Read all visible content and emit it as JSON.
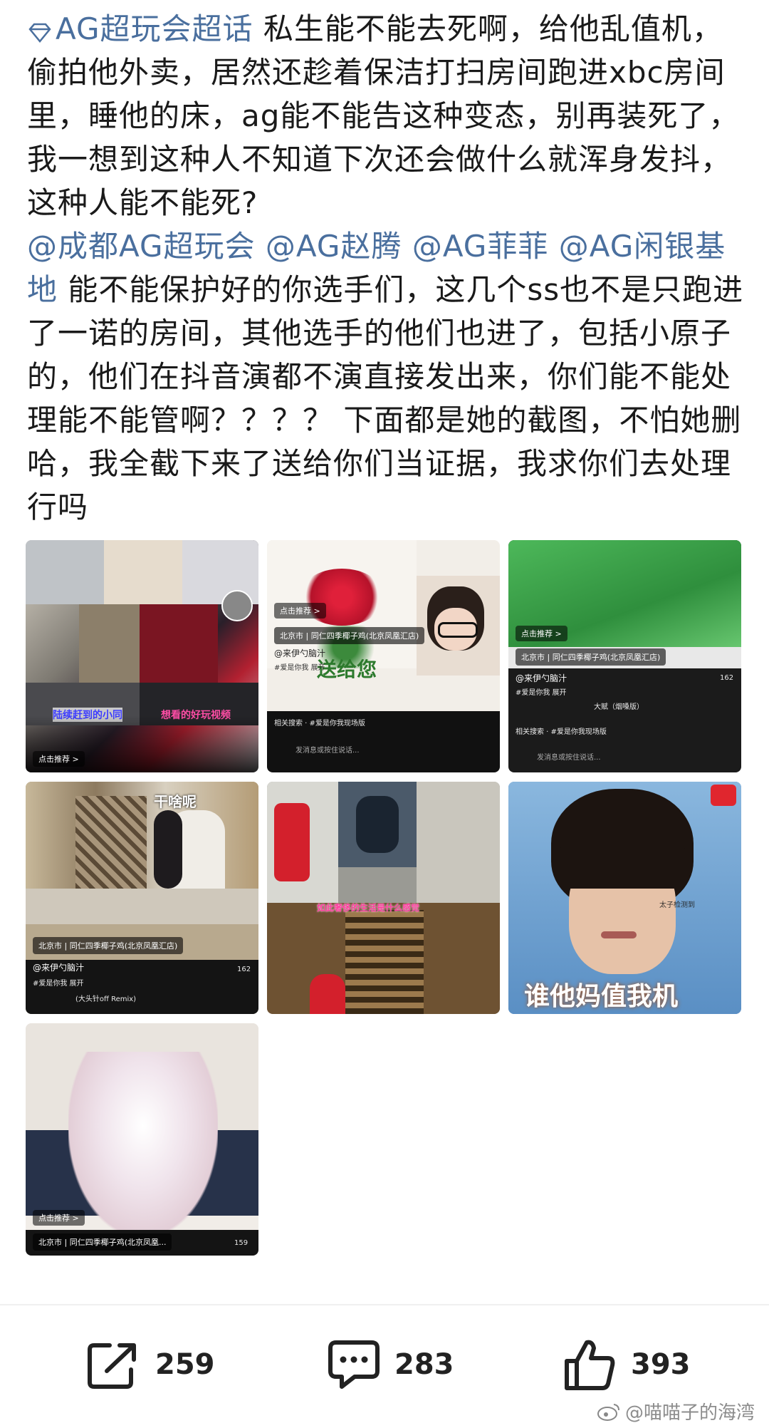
{
  "post": {
    "topic": "AG超玩会超话",
    "text1": " 私生能不能去死啊，给他乱值机，偷拍他外卖，居然还趁着保洁打扫房间跑进xbc房间里，睡他的床，ag能不能告这种变态，别再装死了，我一想到这种人不知道下次还会做什么就浑身发抖，这种人能不能死?",
    "mentions": [
      "@成都AG超玩会",
      "@AG赵腾",
      "@AG菲菲",
      "@AG闲银基地"
    ],
    "text2": " 能不能保护好的你选手们，这几个ss也不是只跑进了一诺的房间，其他选手的他们也进了，包括小原子的，他们在抖音演都不演直接发出来，你们能不能处理能不能管啊？？？？ 下面都是她的截图，不怕她删哈，我全截下来了送给你们当证据，我求你们去处理行吗"
  },
  "images": [
    {
      "overlay": "陆续赶到的小同",
      "overlay2": "想看的好玩视频",
      "badge": "点击推荐 >"
    },
    {
      "badge": "点击推荐 >",
      "location": "北京市 | 同仁四季椰子鸡(北京凤凰汇店)",
      "author": "@来伊勺脑汁",
      "tag": "#爱是你我  展开",
      "search": "相关搜索 · #爱是你我现场版",
      "input": "发消息或按住说话...",
      "center": "送给您"
    },
    {
      "badge": "点击推荐 >",
      "location": "北京市 | 同仁四季椰子鸡(北京凤凰汇店)",
      "author": "@来伊勺脑汁",
      "tag": "#爱是你我  展开",
      "music": "大赋（烟嗓版）",
      "search": "相关搜索 · #爱是你我现场版",
      "input": "发消息或按住说话...",
      "count": "162"
    },
    {
      "overlay": "干啥呢",
      "location": "北京市 | 同仁四季椰子鸡(北京凤凰汇店)",
      "author": "@来伊勺脑汁",
      "tag": "#爱是你我  展开",
      "music": "(大头针off Remix)",
      "count": "162"
    },
    {
      "overlay": "如此奢侈的生活是什么感觉"
    },
    {
      "overlay": "谁他妈值我机",
      "label": "太子检测到"
    },
    {
      "badge": "点击推荐 >",
      "location": "北京市 | 同仁四季椰子鸡(北京凤凰...",
      "count": "159"
    }
  ],
  "actions": {
    "share": "259",
    "comment": "283",
    "like": "393"
  },
  "watermark": "@喵喵子的海湾",
  "colors": {
    "link": "#4a6f9e",
    "text": "#1a1a1a"
  }
}
